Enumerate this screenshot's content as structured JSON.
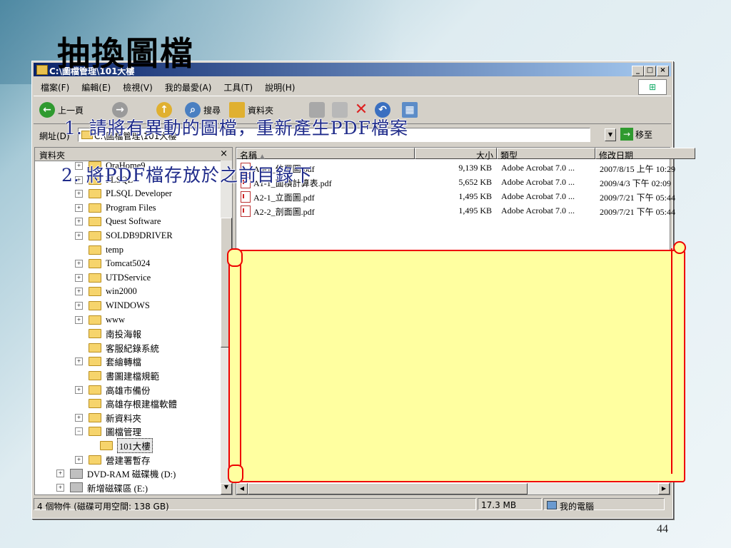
{
  "slide": {
    "title": "抽換圖檔",
    "page_number": "44",
    "steps": [
      "1. 請將有異動的圖檔，重新產生PDF檔案",
      "2. 將PDF檔存放於之前目錄下"
    ]
  },
  "window": {
    "title": "C:\\圖檔管理\\101大樓",
    "controls": {
      "minimize": "_",
      "maximize": "□",
      "close": "×"
    },
    "menu": [
      "檔案(F)",
      "編輯(E)",
      "檢視(V)",
      "我的最愛(A)",
      "工具(T)",
      "說明(H)"
    ],
    "toolbar": {
      "back": "上一頁",
      "search": "搜尋",
      "folders": "資料夾"
    },
    "address": {
      "label": "網址(D)",
      "value": "C:\\圖檔管理\\101大樓",
      "go": "移至"
    }
  },
  "folder_pane": {
    "header": "資料夾",
    "close": "×",
    "items": [
      {
        "label": "OraHome9",
        "expander": "+",
        "level": 1
      },
      {
        "label": "PLSQL",
        "expander": "+",
        "level": 1
      },
      {
        "label": "PLSQL Developer",
        "expander": "+",
        "level": 1
      },
      {
        "label": "Program Files",
        "expander": "+",
        "level": 1
      },
      {
        "label": "Quest Software",
        "expander": "+",
        "level": 1
      },
      {
        "label": "SOLDB9DRIVER",
        "expander": "+",
        "level": 1
      },
      {
        "label": "temp",
        "expander": "",
        "level": 1
      },
      {
        "label": "Tomcat5024",
        "expander": "+",
        "level": 1
      },
      {
        "label": "UTDService",
        "expander": "+",
        "level": 1
      },
      {
        "label": "win2000",
        "expander": "+",
        "level": 1
      },
      {
        "label": "WINDOWS",
        "expander": "+",
        "level": 1
      },
      {
        "label": "www",
        "expander": "+",
        "level": 1
      },
      {
        "label": "南投海報",
        "expander": "",
        "level": 1
      },
      {
        "label": "客服紀錄系統",
        "expander": "",
        "level": 1
      },
      {
        "label": "套繪轉檔",
        "expander": "+",
        "level": 1
      },
      {
        "label": "書圖建檔規範",
        "expander": "",
        "level": 1
      },
      {
        "label": "高雄市備份",
        "expander": "+",
        "level": 1
      },
      {
        "label": "高雄存根建檔軟體",
        "expander": "",
        "level": 1
      },
      {
        "label": "新資料夾",
        "expander": "+",
        "level": 1
      },
      {
        "label": "圖檔管理",
        "expander": "−",
        "level": 1
      },
      {
        "label": "101大樓",
        "expander": "",
        "level": 2,
        "selected": true
      },
      {
        "label": "營建署暫存",
        "expander": "+",
        "level": 1
      },
      {
        "label": "DVD-RAM 磁碟機 (D:)",
        "expander": "+",
        "level": 0,
        "drive": true
      },
      {
        "label": "新增磁碟區 (E:)",
        "expander": "+",
        "level": 0,
        "drive": true
      }
    ]
  },
  "file_pane": {
    "columns": {
      "name": "名稱",
      "size": "大小",
      "type": "類型",
      "modified": "修改日期"
    },
    "files": [
      {
        "name": "A0-1_位置圖.pdf",
        "size": "9,139 KB",
        "type": "Adobe Acrobat 7.0 ...",
        "modified": "2007/8/15 上午 10:29"
      },
      {
        "name": "A1-1_面積計算表.pdf",
        "size": "5,652 KB",
        "type": "Adobe Acrobat 7.0 ...",
        "modified": "2009/4/3 下午 02:09"
      },
      {
        "name": "A2-1_立面圖.pdf",
        "size": "1,495 KB",
        "type": "Adobe Acrobat 7.0 ...",
        "modified": "2009/7/21 下午 05:44"
      },
      {
        "name": "A2-2_剖面圖.pdf",
        "size": "1,495 KB",
        "type": "Adobe Acrobat 7.0 ...",
        "modified": "2009/7/21 下午 05:44"
      }
    ]
  },
  "status": {
    "objects": "4 個物件 (磁碟可用空間: 138 GB)",
    "size": "17.3 MB",
    "location": "我的電腦"
  }
}
